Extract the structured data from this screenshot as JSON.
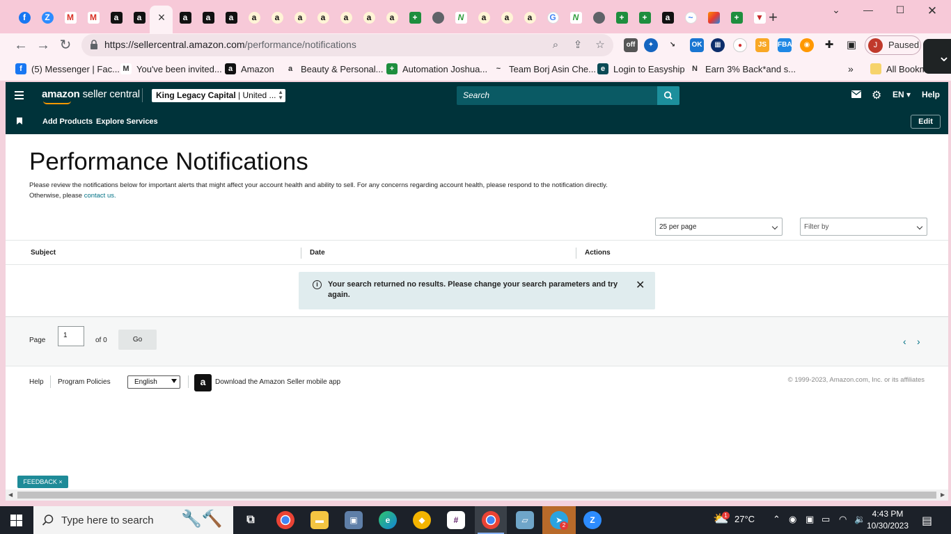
{
  "browser": {
    "tabs": [
      {
        "icon": "facebook-icon",
        "glyph": "f",
        "cls": "fav-fb"
      },
      {
        "icon": "zoom-icon",
        "glyph": "Z",
        "cls": "fav-z"
      },
      {
        "icon": "gmail-icon",
        "glyph": "M",
        "cls": "fav-m"
      },
      {
        "icon": "gmail-icon",
        "glyph": "M",
        "cls": "fav-m"
      },
      {
        "icon": "amazon-icon",
        "glyph": "a",
        "cls": "fav-a"
      },
      {
        "icon": "amazon-icon",
        "glyph": "a",
        "cls": "fav-a"
      },
      {
        "icon": "amazon-icon",
        "glyph": "a",
        "cls": "fav-a"
      },
      {
        "icon": "amazon-icon",
        "glyph": "a",
        "cls": "fav-a"
      },
      {
        "icon": "amazon-icon",
        "glyph": "a",
        "cls": "fav-a"
      },
      {
        "icon": "amazon-smile-icon",
        "glyph": "a",
        "cls": "fav-ao"
      },
      {
        "icon": "amazon-smile-icon",
        "glyph": "a",
        "cls": "fav-ao"
      },
      {
        "icon": "amazon-smile-icon",
        "glyph": "a",
        "cls": "fav-ao"
      },
      {
        "icon": "amazon-smile-icon",
        "glyph": "a",
        "cls": "fav-ao"
      },
      {
        "icon": "amazon-smile-icon",
        "glyph": "a",
        "cls": "fav-ao"
      },
      {
        "icon": "amazon-smile-icon",
        "glyph": "a",
        "cls": "fav-ao"
      },
      {
        "icon": "amazon-smile-icon",
        "glyph": "a",
        "cls": "fav-ao"
      },
      {
        "icon": "sheets-plus-icon",
        "glyph": "+",
        "cls": "fav-plus"
      },
      {
        "icon": "globe-icon",
        "glyph": "",
        "cls": "fav-globe"
      },
      {
        "icon": "n-logo-icon",
        "glyph": "N",
        "cls": "fav-n"
      },
      {
        "icon": "amazon-smile-icon",
        "glyph": "a",
        "cls": "fav-ao"
      },
      {
        "icon": "amazon-smile-icon",
        "glyph": "a",
        "cls": "fav-ao"
      },
      {
        "icon": "amazon-smile-icon",
        "glyph": "a",
        "cls": "fav-ao"
      },
      {
        "icon": "google-icon",
        "glyph": "G",
        "cls": "fav-g"
      },
      {
        "icon": "n-logo-icon",
        "glyph": "N",
        "cls": "fav-n"
      },
      {
        "icon": "globe-icon",
        "glyph": "",
        "cls": "fav-globe"
      },
      {
        "icon": "sheets-plus-icon",
        "glyph": "+",
        "cls": "fav-plus"
      },
      {
        "icon": "sheets-plus-icon",
        "glyph": "+",
        "cls": "fav-plus"
      },
      {
        "icon": "amazon-icon",
        "glyph": "a",
        "cls": "fav-a"
      },
      {
        "icon": "wave-icon",
        "glyph": "~",
        "cls": "fav-g"
      },
      {
        "icon": "colorful-app-icon",
        "glyph": "",
        "cls": "fav-multi"
      },
      {
        "icon": "sheets-plus-icon",
        "glyph": "+",
        "cls": "fav-plus"
      },
      {
        "icon": "red-triangle-icon",
        "glyph": "▼",
        "cls": "fav-red"
      }
    ],
    "url_host": "https://sellercentral.amazon.com",
    "url_path": "/performance/notifications",
    "profile_initial": "J",
    "profile_status": "Paused",
    "bookmarks": [
      {
        "label": "(5) Messenger | Fac...",
        "icon": "facebook-icon",
        "color": "#1877f2",
        "glyph": "f"
      },
      {
        "label": "You've been invited...",
        "icon": "gmail-icon",
        "color": "#ffffff",
        "glyph": "M"
      },
      {
        "label": "Amazon",
        "icon": "amazon-icon",
        "color": "#111111",
        "glyph": "a"
      },
      {
        "label": "Beauty & Personal...",
        "icon": "amazon-smile-icon",
        "color": "#fdf1f5",
        "glyph": "a"
      },
      {
        "label": "Automation Joshua...",
        "icon": "sheets-plus-icon",
        "color": "#1e8e3e",
        "glyph": "+"
      },
      {
        "label": "Team Borj Asin Che...",
        "icon": "tb-logo-icon",
        "color": "#fdf1f5",
        "glyph": "~"
      },
      {
        "label": "Login to Easyship",
        "icon": "easyship-icon",
        "color": "#0b4a55",
        "glyph": "e"
      },
      {
        "label": "Earn 3% Back*and s...",
        "icon": "n-logo-icon",
        "color": "#fdf1f5",
        "glyph": "N"
      }
    ],
    "all_bookmarks": "All Bookm"
  },
  "seller": {
    "logo_bold": "amazon",
    "logo_light": " seller central",
    "account": "King Legacy Capital",
    "account_suffix": " | United ...",
    "search_placeholder": "Search",
    "lang": "EN",
    "help": "Help",
    "nav_add_products": "Add Products",
    "nav_explore": "Explore Services",
    "edit": "Edit"
  },
  "page": {
    "title": "Performance Notifications",
    "desc_1": "Please review the notifications below for important alerts that might affect your account health and ability to sell. For any concerns regarding account health, please respond to the notification directly. Otherwise, please ",
    "desc_link": "contact us.",
    "per_page": "25 per page",
    "filter": "Filter by",
    "columns": [
      "Subject",
      "Date",
      "Actions"
    ],
    "alert": "Your search returned no results. Please change your search parameters and try again.",
    "page_label": "Page",
    "page_value": "1",
    "of_label": "of 0",
    "go": "Go",
    "footer_help": "Help",
    "footer_policies": "Program Policies",
    "footer_lang": "English",
    "footer_app": "Download the Amazon Seller mobile app",
    "copyright": "© 1999-2023, Amazon.com, Inc. or its affiliates",
    "feedback": "FEEDBACK ×"
  },
  "taskbar": {
    "search_placeholder": "Type here to search",
    "weather_temp": "27°C",
    "time": "4:43 PM",
    "date": "10/30/2023",
    "weather_badge": "1",
    "telegram_badge": "2"
  }
}
